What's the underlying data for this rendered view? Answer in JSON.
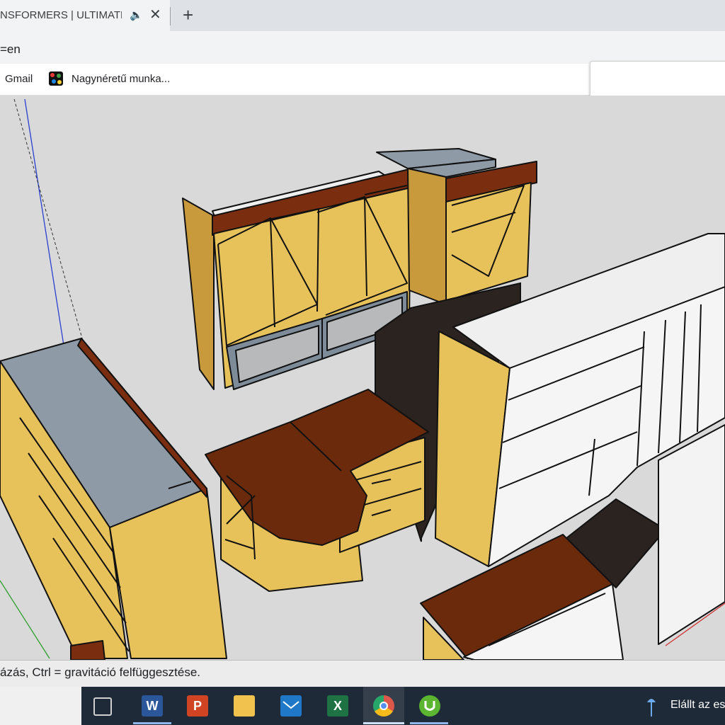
{
  "browser": {
    "tab_title": "NSFORMERS | ULTIMATE",
    "tab_audio_icon": "🔈",
    "tab_close": "✕",
    "new_tab": "+",
    "url_fragment": "=en",
    "bookmarks": [
      {
        "label": "Gmail"
      },
      {
        "label": "Nagynéretű munka..."
      }
    ]
  },
  "app": {
    "status_hint": "ázás, Ctrl = gravitáció felfüggesztése."
  },
  "taskbar": {
    "apps": [
      {
        "name": "task-view",
        "glyph": ""
      },
      {
        "name": "word",
        "glyph": "W"
      },
      {
        "name": "powerpoint",
        "glyph": "P"
      },
      {
        "name": "file-explorer",
        "glyph": ""
      },
      {
        "name": "mail",
        "glyph": ""
      },
      {
        "name": "excel",
        "glyph": "X"
      },
      {
        "name": "chrome",
        "glyph": ""
      },
      {
        "name": "utorrent",
        "glyph": ""
      }
    ],
    "notification_text": "Elállt az es"
  },
  "colors": {
    "wood_light": "#e9c45e",
    "wood_dark": "#6b2a0c",
    "glass": "#8e9aa6",
    "black": "#2a2320",
    "white_panel": "#f4f4f4"
  }
}
